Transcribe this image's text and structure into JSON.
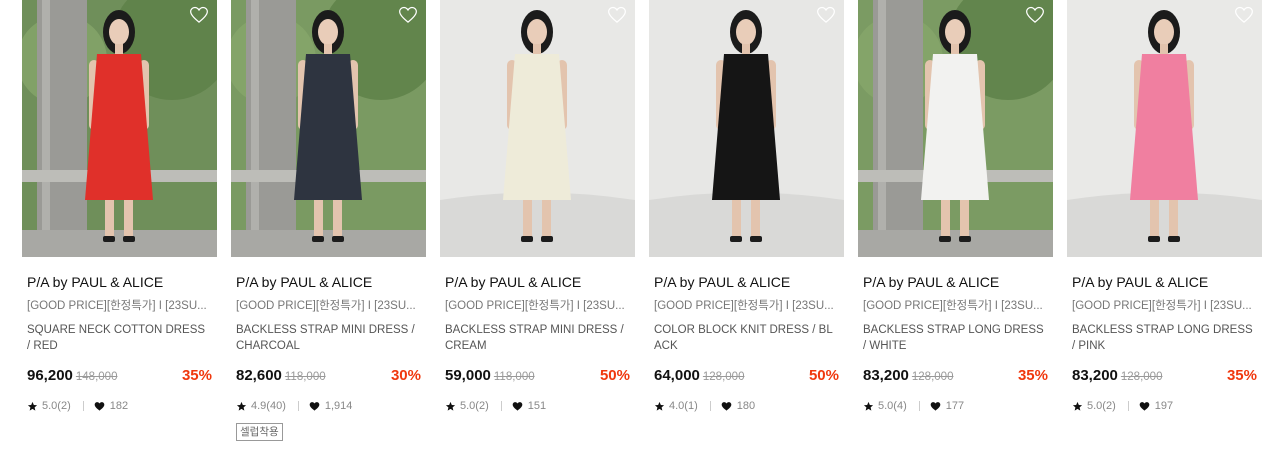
{
  "products": [
    {
      "brand": "P/A by PAUL & ALICE",
      "tagline": "[GOOD PRICE][한정특가] I [23SU...",
      "name": "SQUARE NECK COTTON DRESS / RED",
      "price": "96,200",
      "original_price": "148,000",
      "discount": "35%",
      "rating": "5.0(2)",
      "likes": "182",
      "badge": "",
      "photo": {
        "bg": "#6f8f5a",
        "garment": "#e0302a",
        "style": "outdoor"
      }
    },
    {
      "brand": "P/A by PAUL & ALICE",
      "tagline": "[GOOD PRICE][한정특가] I [23SU...",
      "name": "BACKLESS STRAP MINI DRESS / CHARCOAL",
      "price": "82,600",
      "original_price": "118,000",
      "discount": "30%",
      "rating": "4.9(40)",
      "likes": "1,914",
      "badge": "셀럽착용",
      "photo": {
        "bg": "#7a9a62",
        "garment": "#2e3440",
        "style": "outdoor"
      }
    },
    {
      "brand": "P/A by PAUL & ALICE",
      "tagline": "[GOOD PRICE][한정특가] I [23SU...",
      "name": "BACKLESS STRAP MINI DRESS / CREAM",
      "price": "59,000",
      "original_price": "118,000",
      "discount": "50%",
      "rating": "5.0(2)",
      "likes": "151",
      "badge": "",
      "photo": {
        "bg": "#e4e4e2",
        "garment": "#eeebd9",
        "style": "studio"
      }
    },
    {
      "brand": "P/A by PAUL & ALICE",
      "tagline": "[GOOD PRICE][한정특가] I [23SU...",
      "name": "COLOR BLOCK KNIT DRESS / BLACK",
      "price": "64,000",
      "original_price": "128,000",
      "discount": "50%",
      "rating": "4.0(1)",
      "likes": "180",
      "badge": "",
      "photo": {
        "bg": "#e2e2e0",
        "garment": "#151515",
        "style": "studio"
      }
    },
    {
      "brand": "P/A by PAUL & ALICE",
      "tagline": "[GOOD PRICE][한정특가] I [23SU...",
      "name": "BACKLESS STRAP LONG DRESS / WHITE",
      "price": "83,200",
      "original_price": "128,000",
      "discount": "35%",
      "rating": "5.0(4)",
      "likes": "177",
      "badge": "",
      "photo": {
        "bg": "#7b9b63",
        "garment": "#f2f2f0",
        "style": "outdoor"
      }
    },
    {
      "brand": "P/A by PAUL & ALICE",
      "tagline": "[GOOD PRICE][한정특가] I [23SU...",
      "name": "BACKLESS STRAP LONG DRESS / PINK",
      "price": "83,200",
      "original_price": "128,000",
      "discount": "35%",
      "rating": "5.0(2)",
      "likes": "197",
      "badge": "",
      "photo": {
        "bg": "#e6e6e4",
        "garment": "#f07fa0",
        "style": "studio"
      }
    }
  ],
  "icons": {
    "wishlist": "heart-outline-icon",
    "rating": "star-icon",
    "likes": "heart-icon"
  },
  "colors": {
    "discount": "#f0380e",
    "price": "#111111",
    "muted": "#888888"
  }
}
